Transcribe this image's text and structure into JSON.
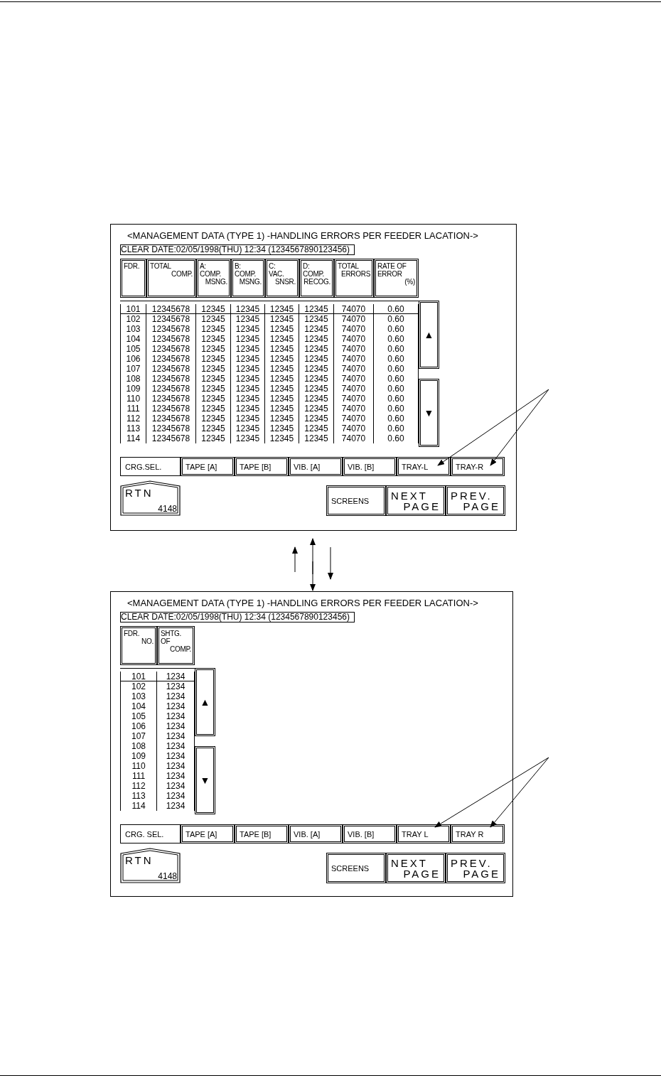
{
  "screens": [
    {
      "title": "<MANAGEMENT DATA (TYPE 1) -HANDLING ERRORS PER FEEDER LACATION->",
      "clear_date": "CLEAR DATE:02/05/1998(THU) 12:34 (1234567890123456)",
      "columns": [
        {
          "lines": [
            "FDR."
          ]
        },
        {
          "lines": [
            "TOTAL",
            "COMP."
          ]
        },
        {
          "lines": [
            "A:",
            "COMP.",
            "MSNG."
          ]
        },
        {
          "lines": [
            "B:",
            "COMP.",
            "MSNG."
          ]
        },
        {
          "lines": [
            "C:",
            "VAC.",
            "SNSR."
          ]
        },
        {
          "lines": [
            "D:",
            "COMP.",
            "RECOG."
          ]
        },
        {
          "lines": [
            "TOTAL",
            "ERRORS"
          ]
        },
        {
          "lines": [
            "RATE OF",
            "ERROR",
            "(%)"
          ]
        }
      ],
      "rows": [
        [
          "101",
          "12345678",
          "12345",
          "12345",
          "12345",
          "12345",
          "74070",
          "0.60"
        ],
        [
          "102",
          "12345678",
          "12345",
          "12345",
          "12345",
          "12345",
          "74070",
          "0.60"
        ],
        [
          "103",
          "12345678",
          "12345",
          "12345",
          "12345",
          "12345",
          "74070",
          "0.60"
        ],
        [
          "104",
          "12345678",
          "12345",
          "12345",
          "12345",
          "12345",
          "74070",
          "0.60"
        ],
        [
          "105",
          "12345678",
          "12345",
          "12345",
          "12345",
          "12345",
          "74070",
          "0.60"
        ],
        [
          "106",
          "12345678",
          "12345",
          "12345",
          "12345",
          "12345",
          "74070",
          "0.60"
        ],
        [
          "107",
          "12345678",
          "12345",
          "12345",
          "12345",
          "12345",
          "74070",
          "0.60"
        ],
        [
          "108",
          "12345678",
          "12345",
          "12345",
          "12345",
          "12345",
          "74070",
          "0.60"
        ],
        [
          "109",
          "12345678",
          "12345",
          "12345",
          "12345",
          "12345",
          "74070",
          "0.60"
        ],
        [
          "110",
          "12345678",
          "12345",
          "12345",
          "12345",
          "12345",
          "74070",
          "0.60"
        ],
        [
          "111",
          "12345678",
          "12345",
          "12345",
          "12345",
          "12345",
          "74070",
          "0.60"
        ],
        [
          "112",
          "12345678",
          "12345",
          "12345",
          "12345",
          "12345",
          "74070",
          "0.60"
        ],
        [
          "113",
          "12345678",
          "12345",
          "12345",
          "12345",
          "12345",
          "74070",
          "0.60"
        ],
        [
          "114",
          "12345678",
          "12345",
          "12345",
          "12345",
          "12345",
          "74070",
          "0.60"
        ]
      ],
      "scroll": [
        "▲",
        "▼"
      ],
      "carriage_select": {
        "label": "CRG.SEL.",
        "buttons": [
          "TAPE [A]",
          "TAPE [B]",
          "VIB. [A]",
          "VIB. [B]",
          "TRAY-L",
          "TRAY-R"
        ]
      },
      "rtn": {
        "label": "RTN",
        "code": "4148"
      },
      "nav_buttons": [
        {
          "lines": [
            "SCREENS"
          ]
        },
        {
          "lines": [
            "NEXT",
            "PAGE"
          ]
        },
        {
          "lines": [
            "PREV.",
            "PAGE"
          ]
        }
      ]
    },
    {
      "title": "<MANAGEMENT DATA (TYPE 1) -HANDLING ERRORS PER FEEDER LACATION->",
      "clear_date": "CLEAR DATE:02/05/1998(THU) 12:34 (1234567890123456)",
      "columns": [
        {
          "lines": [
            "FDR.",
            "NO."
          ]
        },
        {
          "lines": [
            "SHTG.",
            "OF",
            "COMP."
          ]
        }
      ],
      "rows": [
        [
          "101",
          "1234"
        ],
        [
          "102",
          "1234"
        ],
        [
          "103",
          "1234"
        ],
        [
          "104",
          "1234"
        ],
        [
          "105",
          "1234"
        ],
        [
          "106",
          "1234"
        ],
        [
          "107",
          "1234"
        ],
        [
          "108",
          "1234"
        ],
        [
          "109",
          "1234"
        ],
        [
          "110",
          "1234"
        ],
        [
          "111",
          "1234"
        ],
        [
          "112",
          "1234"
        ],
        [
          "113",
          "1234"
        ],
        [
          "114",
          "1234"
        ]
      ],
      "scroll": [
        "▲",
        "▼"
      ],
      "carriage_select": {
        "label": "CRG. SEL.",
        "buttons": [
          "TAPE [A]",
          "TAPE [B]",
          "VIB. [A]",
          "VIB. [B]",
          "TRAY L",
          "TRAY R"
        ]
      },
      "rtn": {
        "label": "RTN",
        "code": "4148"
      },
      "nav_buttons": [
        {
          "lines": [
            "SCREENS"
          ]
        },
        {
          "lines": [
            "NEXT",
            "PAGE"
          ]
        },
        {
          "lines": [
            "PREV.",
            "PAGE"
          ]
        }
      ]
    }
  ]
}
